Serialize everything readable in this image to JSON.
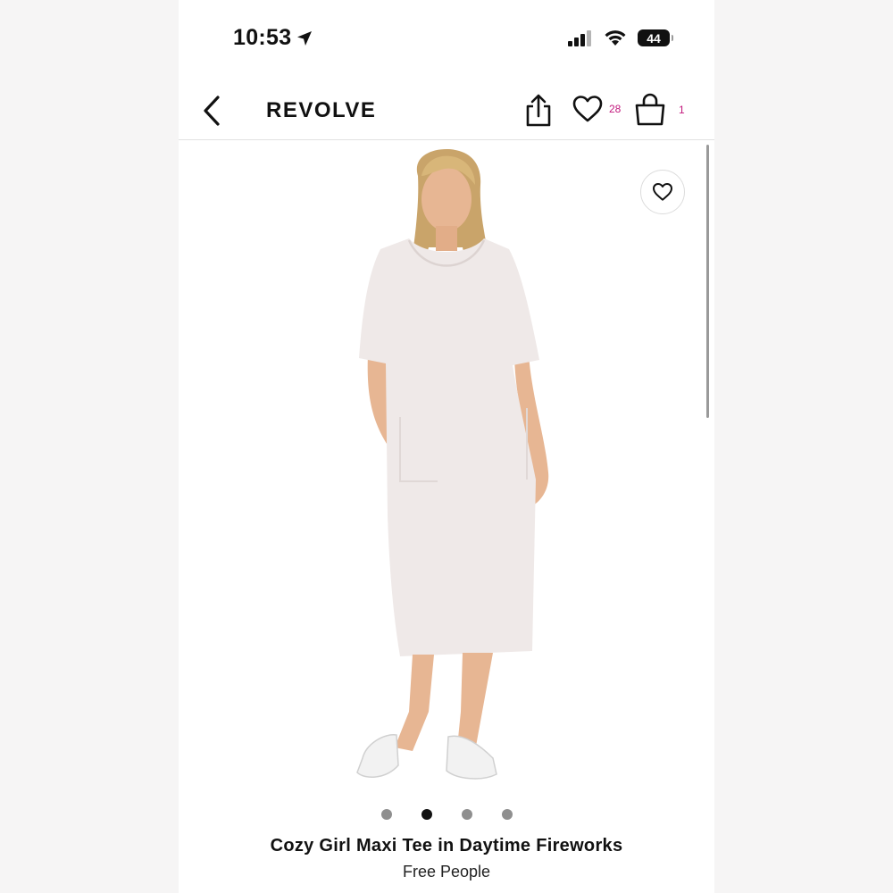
{
  "status_bar": {
    "time": "10:53",
    "battery": "44",
    "icons": [
      "location-arrow-icon",
      "signal-icon",
      "wifi-icon",
      "battery-icon"
    ]
  },
  "header": {
    "brand": "REVOLVE",
    "wishlist_count": "28",
    "bag_count": "1",
    "icons": [
      "back-chevron-icon",
      "share-icon",
      "heart-icon",
      "bag-icon"
    ]
  },
  "product": {
    "title": "Cozy Girl Maxi Tee in Daytime Fireworks",
    "brand": "Free People",
    "image_count": 4,
    "active_image": 2
  },
  "colors": {
    "accent_pink": "#c2187d",
    "text": "#111111",
    "dress": "#efe9e8"
  }
}
